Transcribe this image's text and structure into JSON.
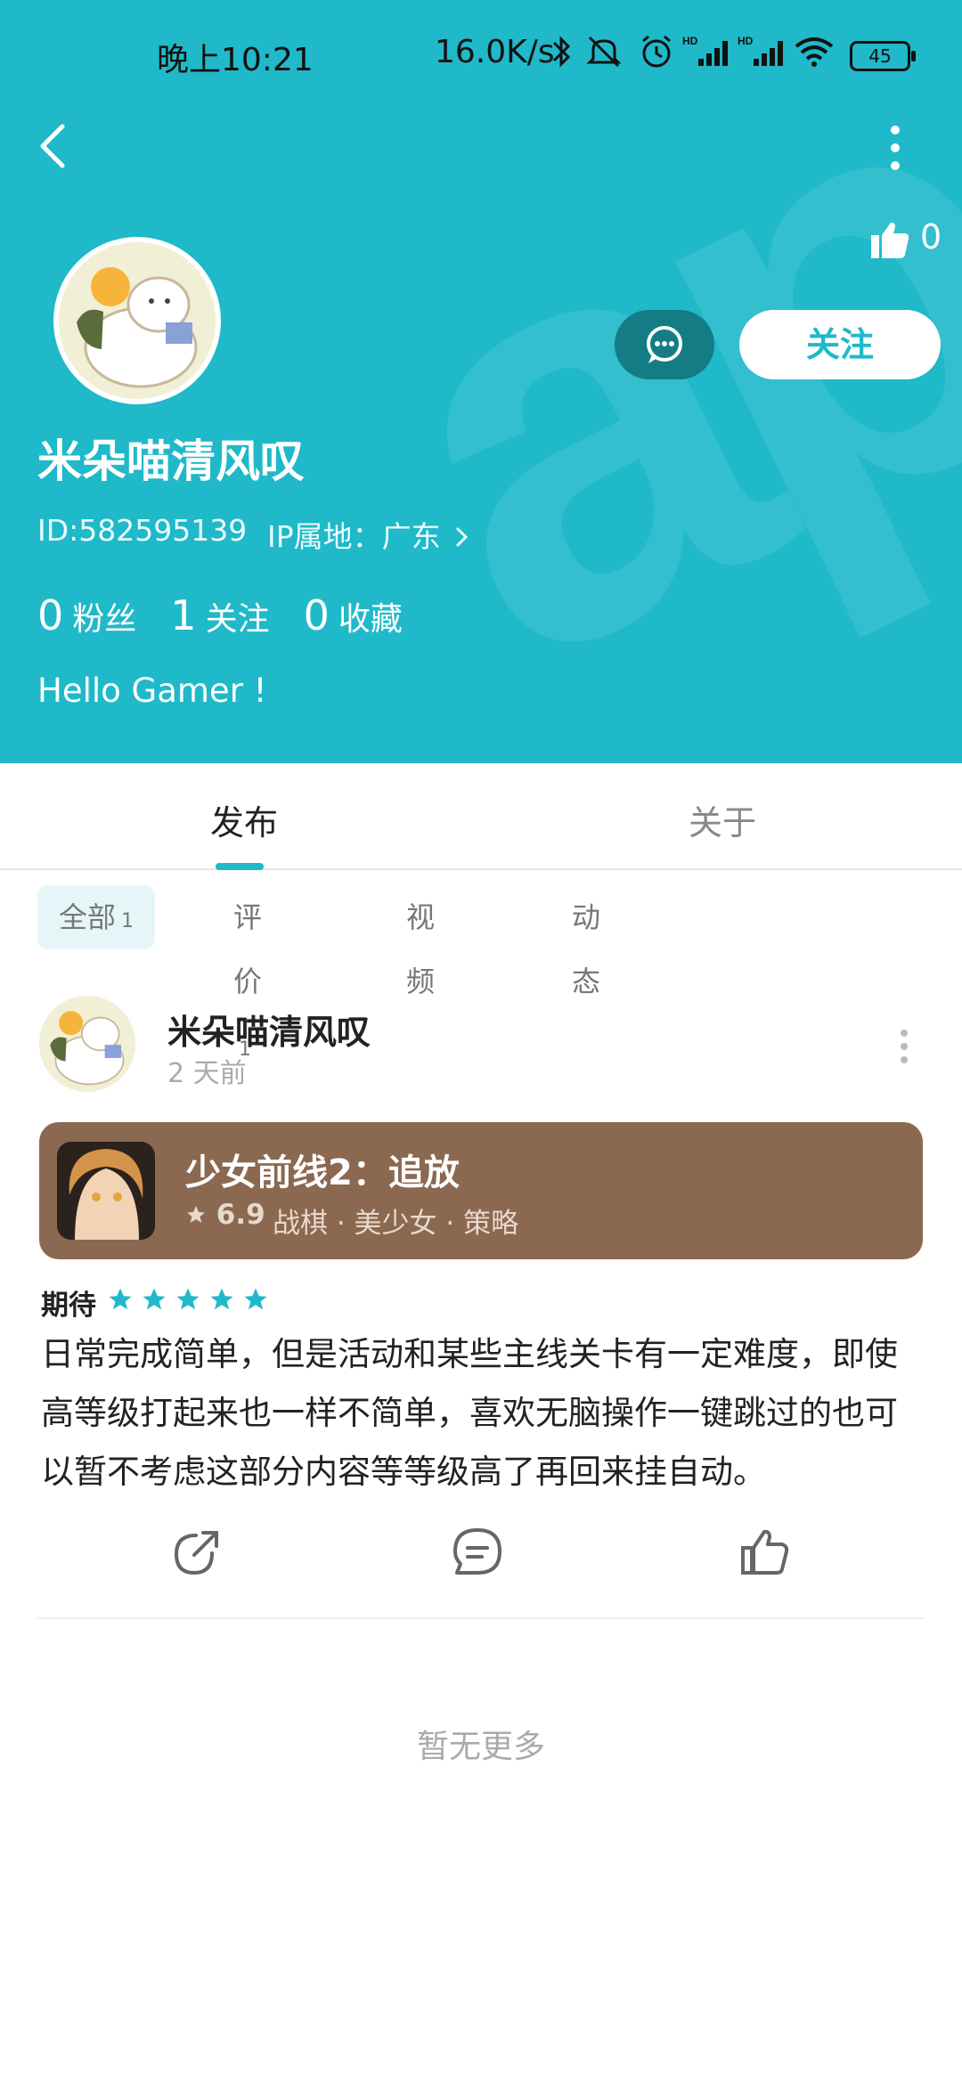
{
  "status_bar": {
    "time": "晚上10:21",
    "net_speed": "16.0K/s",
    "battery": "45"
  },
  "profile": {
    "likes_count": "0",
    "follow_label": "关注",
    "username": "米朵喵清风叹",
    "id_text": "ID:582595139",
    "ip_text": "IP属地：广东",
    "stats": [
      {
        "num": "0",
        "label": "粉丝"
      },
      {
        "num": "1",
        "label": "关注"
      },
      {
        "num": "0",
        "label": "收藏"
      }
    ],
    "bio": "Hello Gamer !"
  },
  "tabs": {
    "publish": "发布",
    "about": "关于"
  },
  "filters": [
    {
      "label": "全部",
      "count": "1"
    },
    {
      "label": "评价",
      "count": "1"
    },
    {
      "label": "视频",
      "count": ""
    },
    {
      "label": "动态",
      "count": ""
    }
  ],
  "post": {
    "user": "米朵喵清风叹",
    "time": "2 天前",
    "game": {
      "title": "少女前线2：追放",
      "rating": "6.9",
      "tags": "战棋 · 美少女 · 策略"
    },
    "expect_label": "期待",
    "stars": 5,
    "review": "日常完成简单，但是活动和某些主线关卡有一定难度，即使高等级打起来也一样不简单，喜欢无脑操作一键跳过的也可以暂不考虑这部分内容等等级高了再回来挂自动。"
  },
  "footer": {
    "no_more": "暂无更多"
  },
  "colors": {
    "accent": "#1fb9c9",
    "game_card": "#8b6850"
  }
}
